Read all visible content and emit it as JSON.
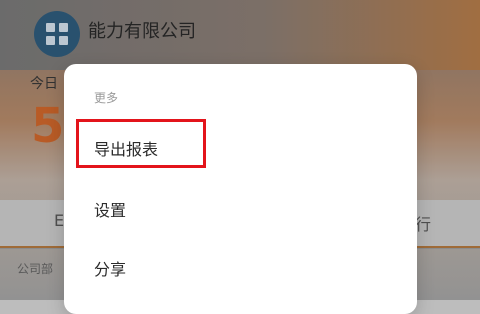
{
  "background": {
    "company_name": "能力有限公司",
    "today_label": "今日",
    "today_value": "5",
    "tab_left": "E",
    "tab_right": "行",
    "subrow_label": "公司部"
  },
  "popup": {
    "title": "更多",
    "items": [
      {
        "label": "导出报表"
      },
      {
        "label": "设置"
      },
      {
        "label": "分享"
      }
    ]
  },
  "colors": {
    "accent": "#d2682c",
    "highlight": "#e3141b",
    "company_icon_bg": "#2f5d7e"
  },
  "icons": {
    "company": "grid-icon"
  }
}
